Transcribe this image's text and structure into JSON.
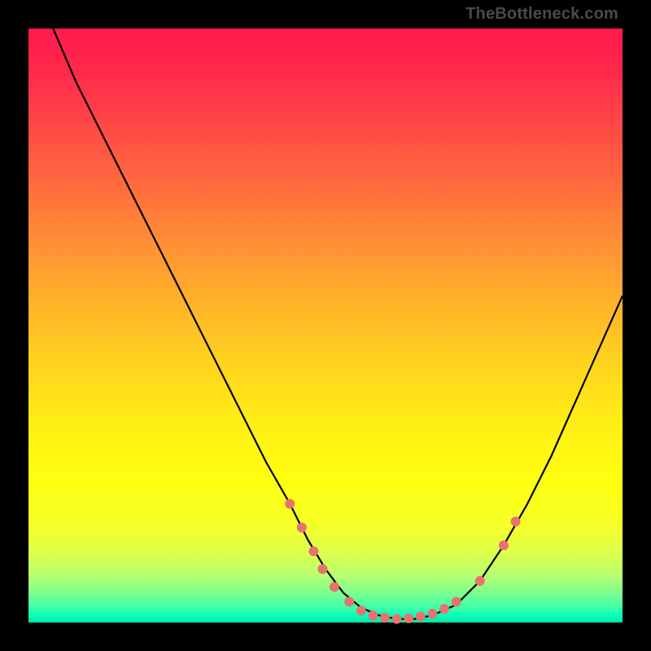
{
  "attribution": "TheBottleneck.com",
  "colors": {
    "top": "#ff1a4d",
    "mid": "#ffed15",
    "bottom": "#00ffb8",
    "curve": "#000000",
    "dots": "#e9716f"
  },
  "chart_data": {
    "type": "line",
    "title": "",
    "xlabel": "",
    "ylabel": "",
    "xlim": [
      0,
      100
    ],
    "ylim": [
      0,
      100
    ],
    "grid": false,
    "legend": false,
    "series": [
      {
        "name": "bottleneck-curve",
        "x": [
          0,
          2,
          5,
          8,
          12,
          16,
          20,
          24,
          28,
          32,
          36,
          40,
          44,
          47,
          50,
          53,
          56,
          59,
          62,
          65,
          68,
          72,
          76,
          80,
          84,
          88,
          92,
          96,
          100
        ],
        "y": [
          110,
          105,
          98,
          91,
          83,
          75,
          67,
          59,
          51,
          43,
          35,
          27,
          20,
          14,
          9,
          5,
          2.5,
          1.2,
          0.6,
          0.6,
          1.2,
          3,
          7,
          13,
          20,
          28,
          37,
          46,
          55
        ]
      }
    ],
    "markers": [
      {
        "x": 44,
        "y": 20
      },
      {
        "x": 46,
        "y": 16
      },
      {
        "x": 48,
        "y": 12
      },
      {
        "x": 49.5,
        "y": 9
      },
      {
        "x": 51.5,
        "y": 6
      },
      {
        "x": 54,
        "y": 3.5
      },
      {
        "x": 56,
        "y": 2
      },
      {
        "x": 58,
        "y": 1.2
      },
      {
        "x": 60,
        "y": 0.8
      },
      {
        "x": 62,
        "y": 0.6
      },
      {
        "x": 64,
        "y": 0.7
      },
      {
        "x": 66,
        "y": 1.0
      },
      {
        "x": 68,
        "y": 1.5
      },
      {
        "x": 70,
        "y": 2.3
      },
      {
        "x": 72,
        "y": 3.5
      },
      {
        "x": 76,
        "y": 7
      },
      {
        "x": 80,
        "y": 13
      },
      {
        "x": 82,
        "y": 17
      }
    ]
  }
}
